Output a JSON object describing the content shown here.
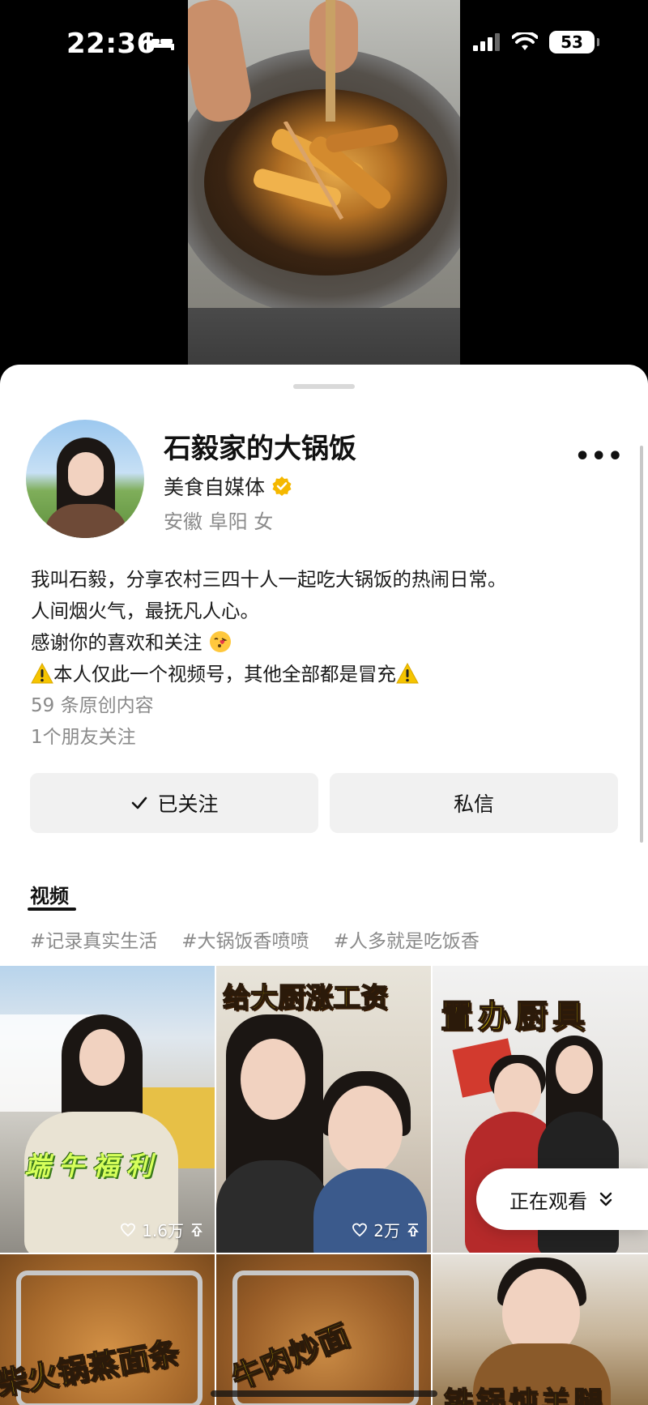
{
  "status_bar": {
    "time": "22:36",
    "battery": "53"
  },
  "profile": {
    "name": "石毅家的大锅饭",
    "category": "美食自媒体",
    "location": "安徽 阜阳 女",
    "bio_lines": [
      "我叫石毅，分享农村三四十人一起吃大锅饭的热闹日常。",
      "人间烟火气，最抚凡人心。",
      "感谢你的喜欢和关注",
      "本人仅此一个视频号，其他全部都是冒充"
    ],
    "original_count": "59 条原创内容",
    "friends_following": "1个朋友关注"
  },
  "actions": {
    "follow_label": "已关注",
    "message_label": "私信"
  },
  "tabs": {
    "videos": "视频"
  },
  "hashtags": [
    "#记录真实生活",
    "#大锅饭香喷喷",
    "#人多就是吃饭香"
  ],
  "videos": [
    {
      "title": "端午福利",
      "likes": "1.6万"
    },
    {
      "title": "给大厨涨工资",
      "likes": "2万"
    },
    {
      "title": "置办厨具",
      "likes": ""
    },
    {
      "title": "柴火锅蒸面条",
      "likes": ""
    },
    {
      "title": "牛肉炒面",
      "likes": ""
    },
    {
      "title": "铁锅炖羊腿",
      "likes": ""
    }
  ],
  "floating": {
    "watching_label": "正在观看"
  },
  "colors": {
    "verified_badge": "#f5b800",
    "overlay_yellow": "#ffe400",
    "overlay_green": "#d6ff5a"
  }
}
